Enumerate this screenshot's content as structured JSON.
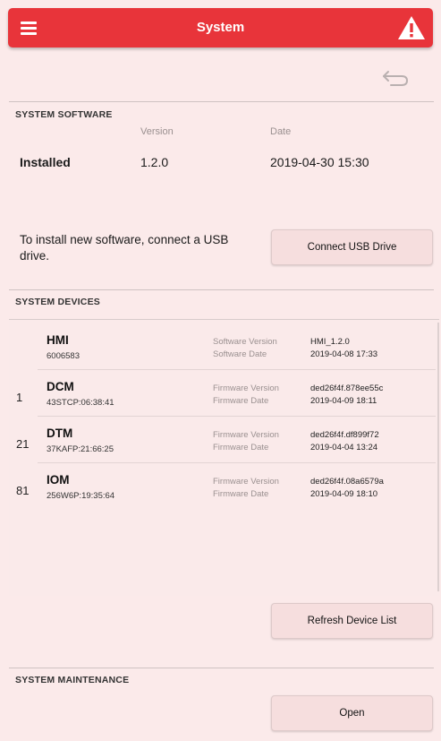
{
  "header": {
    "title": "System"
  },
  "software": {
    "section_title": "SYSTEM SOFTWARE",
    "version_header": "Version",
    "date_header": "Date",
    "installed_label": "Installed",
    "installed_version": "1.2.0",
    "installed_date": "2019-04-30 15:30",
    "install_prompt": "To install new software, connect a USB drive.",
    "connect_button": "Connect USB Drive"
  },
  "devices": {
    "section_title": "SYSTEM DEVICES",
    "items": [
      {
        "id": "",
        "name": "HMI",
        "serial": "6006583",
        "label1": "Software Version",
        "label2": "Software Date",
        "value1": "HMI_1.2.0",
        "value2": "2019-04-08 17:33"
      },
      {
        "id": "1",
        "name": "DCM",
        "serial": "43STCP:06:38:41",
        "label1": "Firmware Version",
        "label2": "Firmware Date",
        "value1": "ded26f4f.878ee55c",
        "value2": "2019-04-09 18:11"
      },
      {
        "id": "21",
        "name": "DTM",
        "serial": "37KAFP:21:66:25",
        "label1": "Firmware Version",
        "label2": "Firmware Date",
        "value1": "ded26f4f.df899f72",
        "value2": "2019-04-04 13:24"
      },
      {
        "id": "81",
        "name": "IOM",
        "serial": "256W6P:19:35:64",
        "label1": "Firmware Version",
        "label2": "Firmware Date",
        "value1": "ded26f4f.08a6579a",
        "value2": "2019-04-09 18:10"
      }
    ],
    "refresh_button": "Refresh Device List"
  },
  "maintenance": {
    "section_title": "SYSTEM MAINTENANCE",
    "open_button": "Open"
  },
  "colors": {
    "header": "#e8343a",
    "background": "#fbeaea"
  }
}
